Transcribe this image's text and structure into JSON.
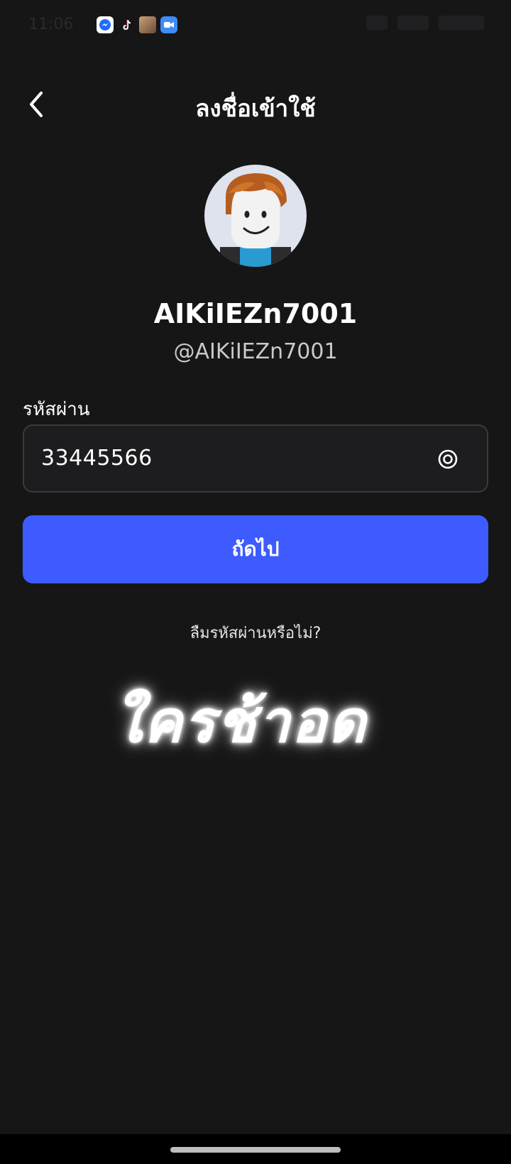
{
  "status_bar": {
    "time": "11:06",
    "notification_icons": [
      "messenger-icon",
      "tiktok-icon",
      "photo-icon",
      "meet-icon"
    ]
  },
  "header": {
    "title": "ลงชื่อเข้าใช้",
    "back_icon": "chevron-left-icon"
  },
  "profile": {
    "display_name": "AIKiIEZn7001",
    "username": "@AIKiIEZn7001"
  },
  "password": {
    "label": "รหัสผ่าน",
    "value": "33445566",
    "toggle_icon": "eye-icon"
  },
  "next_button": {
    "label": "ถัดไป",
    "color": "#3d5bff"
  },
  "forgot_password": "ลืมรหัสผ่านหรือไม่?",
  "overlay_text": "ใครช้าอด",
  "colors": {
    "background": "#161617",
    "field_background": "#1d1d20",
    "field_border": "#3a3a3e",
    "accent": "#3d5bff"
  }
}
